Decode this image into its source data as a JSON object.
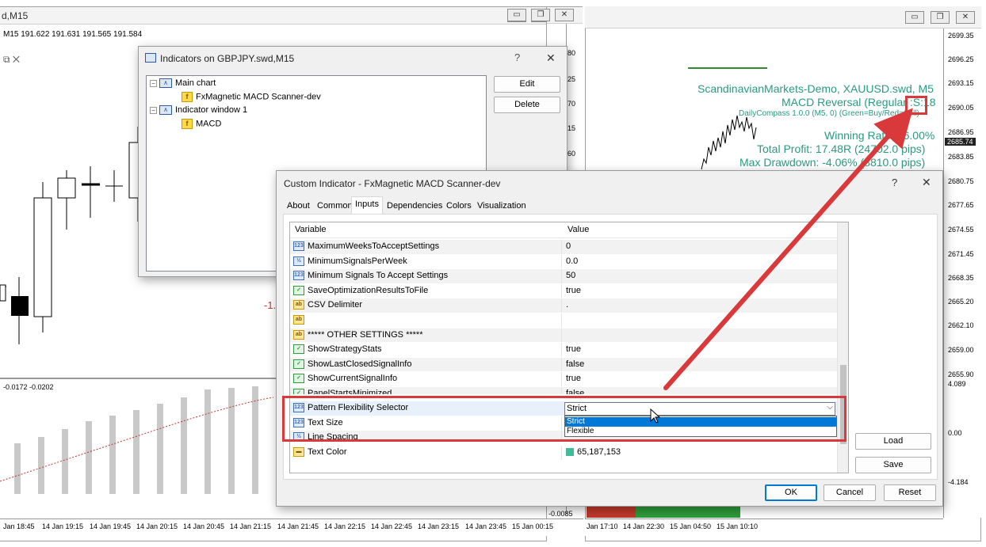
{
  "left_window": {
    "title": "d,M15",
    "price_line": "M15  191.622 191.631 191.565 191.584",
    "price_axis": [
      "80",
      "25",
      "70",
      "15",
      "60"
    ],
    "indicator_label": "-0.0172 -0.0202",
    "indicator_value_right": "-0.0085",
    "stray_text": "-1.",
    "time_axis": [
      "Jan 18:45",
      "14 Jan 19:15",
      "14 Jan 19:45",
      "14 Jan 20:15",
      "14 Jan 20:45",
      "14 Jan 21:15",
      "14 Jan 21:45",
      "14 Jan 22:15",
      "14 Jan 22:45",
      "14 Jan 23:15",
      "14 Jan 23:45",
      "15 Jan 00:15"
    ],
    "minimize": "▭",
    "restore": "❐",
    "close": "✕",
    "panel_icons": "⧉ ✕"
  },
  "right_window": {
    "minimize": "▭",
    "restore": "❐",
    "close": "✕",
    "overlay": {
      "line1": "ScandinavianMarkets-Demo, XAUUSD.swd, M5",
      "line2": "MACD Reversal (Regular :S:18",
      "line3": "DailyCompass 1.0.0 (M5, 0) (Green=Buy/Red=Sell)",
      "line4": "Winning Rate: 46.00%",
      "line5": "Total Profit: 17.48R (24702.0 pips)",
      "line6": "Max Drawdown: -4.06% (8810.0 pips)"
    },
    "price_axis": [
      "2699.35",
      "2696.25",
      "2693.15",
      "2690.05",
      "2686.95",
      "2685.74",
      "2683.85",
      "2680.75",
      "2677.65",
      "2674.55",
      "2671.45",
      "2668.35",
      "2665.20",
      "2662.10",
      "2659.00",
      "2655.90",
      "4.089",
      "0.00",
      "-4.184"
    ],
    "time_axis": [
      "Jan 17:10",
      "14 Jan 22:30",
      "15 Jan 04:50",
      "15 Jan 10:10"
    ]
  },
  "indicators_dialog": {
    "title": "Indicators on GBPJPY.swd,M15",
    "help": "?",
    "close": "✕",
    "tree": [
      {
        "label": "Main chart"
      },
      {
        "label": "FxMagnetic MACD Scanner-dev"
      },
      {
        "label": "Indicator window 1"
      },
      {
        "label": "MACD"
      }
    ],
    "edit_button": "Edit",
    "delete_button": "Delete"
  },
  "custom_dialog": {
    "title": "Custom Indicator - FxMagnetic MACD Scanner-dev",
    "help": "?",
    "close": "✕",
    "tabs": [
      "About",
      "Common",
      "Inputs",
      "Dependencies",
      "Colors",
      "Visualization"
    ],
    "active_tab": "Inputs",
    "columns": {
      "variable": "Variable",
      "value": "Value"
    },
    "rows": [
      {
        "icon": "123",
        "variable": "MaximumWeeksToAcceptSettings",
        "value": "0"
      },
      {
        "icon": "½",
        "variable": "MinimumSignalsPerWeek",
        "value": "0.0"
      },
      {
        "icon": "123",
        "variable": "Minimum Signals To Accept Settings",
        "value": "50"
      },
      {
        "icon": "✓",
        "variable": "SaveOptimizationResultsToFile",
        "value": "true"
      },
      {
        "icon": "ab",
        "variable": "CSV Delimiter",
        "value": "."
      },
      {
        "icon": "ab",
        "variable": "",
        "value": ""
      },
      {
        "icon": "ab",
        "variable": "***** OTHER SETTINGS *****",
        "value": ""
      },
      {
        "icon": "✓",
        "variable": "ShowStrategyStats",
        "value": "true"
      },
      {
        "icon": "✓",
        "variable": "ShowLastClosedSignalInfo",
        "value": "false"
      },
      {
        "icon": "✓",
        "variable": "ShowCurrentSignalInfo",
        "value": "true"
      },
      {
        "icon": "✓",
        "variable": "PanelStartsMinimized",
        "value": "false"
      },
      {
        "icon": "123",
        "variable": "Pattern Flexibility Selector",
        "value": "Strict"
      },
      {
        "icon": "123",
        "variable": "Text Size",
        "value": ""
      },
      {
        "icon": "½",
        "variable": "Line Spacing",
        "value": ""
      },
      {
        "icon": "▬",
        "variable": "Text Color",
        "value": "65,187,153"
      }
    ],
    "dropdown_options": [
      "Strict",
      "Flexible"
    ],
    "text_color_swatch": "#41bb99",
    "load_button": "Load",
    "save_button": "Save",
    "ok_button": "OK",
    "cancel_button": "Cancel",
    "reset_button": "Reset"
  },
  "colors": {
    "annotation": "#d9393b",
    "overlay_text": "#2a9a82",
    "selection": "#0078d7"
  }
}
